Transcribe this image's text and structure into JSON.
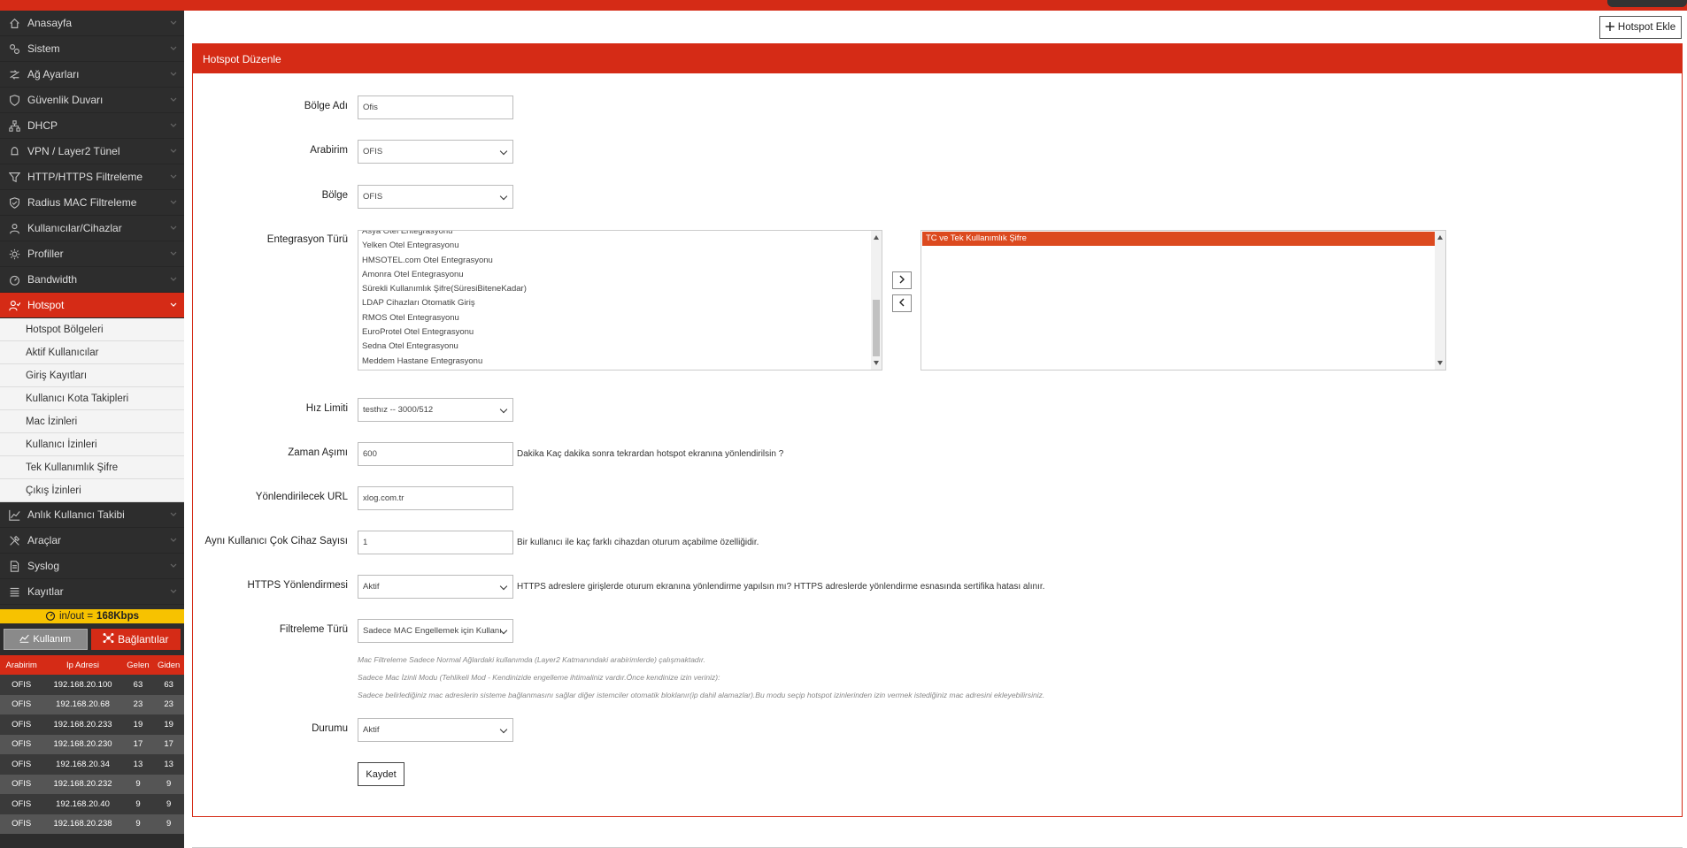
{
  "sidebar": {
    "items": [
      {
        "label": "Anasayfa",
        "icon": "home-icon"
      },
      {
        "label": "Sistem",
        "icon": "settings-icon"
      },
      {
        "label": "Ağ Ayarları",
        "icon": "network-icon"
      },
      {
        "label": "Güvenlik Duvarı",
        "icon": "shield-icon"
      },
      {
        "label": "DHCP",
        "icon": "sitemap-icon"
      },
      {
        "label": "VPN / Layer2 Tünel",
        "icon": "bell-icon"
      },
      {
        "label": "HTTP/HTTPS Filtreleme",
        "icon": "filter-icon"
      },
      {
        "label": "Radius MAC Filtreleme",
        "icon": "shield-check-icon"
      },
      {
        "label": "Kullanıcılar/Cihazlar",
        "icon": "user-icon"
      },
      {
        "label": "Profiller",
        "icon": "gear-icon"
      },
      {
        "label": "Bandwidth",
        "icon": "gauge-icon"
      },
      {
        "label": "Hotspot",
        "icon": "user-check-icon"
      }
    ],
    "hotspot_submenu": [
      "Hotspot Bölgeleri",
      "Aktif Kullanıcılar",
      "Giriş Kayıtları",
      "Kullanıcı Kota Takipleri",
      "Mac İzinleri",
      "Kullanıcı İzinleri",
      "Tek Kullanımlık Şifre",
      "Çıkış İzinleri"
    ],
    "items_after": [
      {
        "label": "Anlık Kullanıcı Takibi",
        "icon": "chart-line-icon"
      },
      {
        "label": "Araçlar",
        "icon": "tools-icon"
      },
      {
        "label": "Syslog",
        "icon": "file-icon"
      },
      {
        "label": "Kayıtlar",
        "icon": "list-icon"
      }
    ],
    "traffic": {
      "label": "in/out =",
      "value": "168Kbps"
    },
    "btn_usage": "Kullanım",
    "btn_connections": "Bağlantılar",
    "table": {
      "headers": [
        "Arabirim",
        "Ip Adresi",
        "Gelen",
        "Giden"
      ],
      "rows": [
        [
          "OFIS",
          "192.168.20.100",
          "63",
          "63"
        ],
        [
          "OFIS",
          "192.168.20.68",
          "23",
          "23"
        ],
        [
          "OFIS",
          "192.168.20.233",
          "19",
          "19"
        ],
        [
          "OFIS",
          "192.168.20.230",
          "17",
          "17"
        ],
        [
          "OFIS",
          "192.168.20.34",
          "13",
          "13"
        ],
        [
          "OFIS",
          "192.168.20.232",
          "9",
          "9"
        ],
        [
          "OFIS",
          "192.168.20.40",
          "9",
          "9"
        ],
        [
          "OFIS",
          "192.168.20.238",
          "9",
          "9"
        ]
      ]
    }
  },
  "header": {
    "add_button": "Hotspot Ekle"
  },
  "panel": {
    "title": "Hotspot Düzenle"
  },
  "form": {
    "bolge_adi": {
      "label": "Bölge Adı",
      "value": "Ofis"
    },
    "arabirim": {
      "label": "Arabirim",
      "value": "OFIS"
    },
    "bolge": {
      "label": "Bölge",
      "value": "OFIS"
    },
    "entegrasyon": {
      "label": "Entegrasyon Türü",
      "available": [
        "Asya Otel Entegrasyonu",
        "Yelken Otel Entegrasyonu",
        "HMSOTEL.com Otel Entegrasyonu",
        "Amonra Otel Entegrasyonu",
        "Sürekli Kullanımlık Şifre(SüresiBiteneKadar)",
        "LDAP Cihazları Otomatik Giriş",
        "RMOS Otel Entegrasyonu",
        "EuroProtel Otel Entegrasyonu",
        "Sedna Otel Entegrasyonu",
        "Meddem Hastane Entegrasyonu"
      ],
      "selected": [
        "TC ve Tek Kullanımlık Şifre"
      ]
    },
    "hiz_limiti": {
      "label": "Hız Limiti",
      "value": "testhız -- 3000/512"
    },
    "zaman_asimi": {
      "label": "Zaman Aşımı",
      "value": "600",
      "hint": "Dakika Kaç dakika sonra tekrardan hotspot ekranına yönlendirilsin ?"
    },
    "url": {
      "label": "Yönlendirilecek URL",
      "value": "xlog.com.tr"
    },
    "cok_cihaz": {
      "label": "Aynı Kullanıcı Çok Cihaz Sayısı",
      "value": "1",
      "hint": "Bir kullanıcı ile kaç farklı cihazdan oturum açabilme özelliğidir."
    },
    "https": {
      "label": "HTTPS Yönlendirmesi",
      "value": "Aktif",
      "hint": "HTTPS adreslere girişlerde oturum ekranına yönlendirme yapılsın mı? HTTPS adreslerde yönlendirme esnasında sertifika hatası alınır."
    },
    "filtreleme": {
      "label": "Filtreleme Türü",
      "value": "Sadece MAC Engellemek için Kullanı",
      "notes": [
        "Mac Filtreleme Sadece Normal Ağlardaki kullanımda (Layer2 Katmanındaki arabirimlerde) çalışmaktadır.",
        "Sadece Mac İzinli Modu (Tehlikeli Mod - Kendinizide engelleme ihtimaliniz vardır.Önce kendinize izin veriniz):",
        "Sadece belirlediğiniz mac adreslerin sisteme bağlanmasını sağlar diğer istemciler otomatik bloklanır(ip dahil alamazlar).Bu modu seçip hotspot izinlerinden izin vermek istediğiniz mac adresini ekleyebilirsiniz."
      ]
    },
    "durum": {
      "label": "Durumu",
      "value": "Aktif"
    },
    "save": "Kaydet"
  }
}
